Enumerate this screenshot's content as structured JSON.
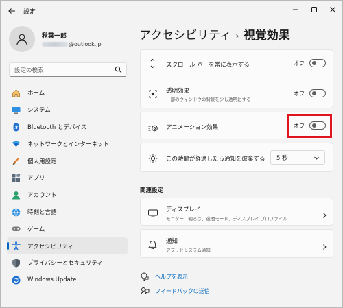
{
  "window": {
    "title": "設定",
    "page_breadcrumb_parent": "アクセシビリティ",
    "page_breadcrumb_sep": "›",
    "page_title": "視覚効果"
  },
  "profile": {
    "name": "秋葉一郎",
    "email_domain": "@outlook.jp"
  },
  "search": {
    "placeholder": "設定の検索"
  },
  "nav": {
    "items": [
      {
        "label": "ホーム",
        "icon": "home-icon"
      },
      {
        "label": "システム",
        "icon": "system-icon"
      },
      {
        "label": "Bluetooth とデバイス",
        "icon": "bluetooth-icon"
      },
      {
        "label": "ネットワークとインターネット",
        "icon": "network-icon"
      },
      {
        "label": "個人用設定",
        "icon": "personalization-icon"
      },
      {
        "label": "アプリ",
        "icon": "apps-icon"
      },
      {
        "label": "アカウント",
        "icon": "account-icon"
      },
      {
        "label": "時刻と言語",
        "icon": "time-language-icon"
      },
      {
        "label": "ゲーム",
        "icon": "gaming-icon"
      },
      {
        "label": "アクセシビリティ",
        "icon": "accessibility-icon",
        "active": true
      },
      {
        "label": "プライバシーとセキュリティ",
        "icon": "privacy-icon"
      },
      {
        "label": "Windows Update",
        "icon": "windows-update-icon"
      }
    ]
  },
  "settings": {
    "scrollbars": {
      "label": "スクロール バーを常に表示する",
      "state": "オフ"
    },
    "transparency": {
      "label": "透明効果",
      "sub": "一部のウィンドウの背景を少し透明にする",
      "state": "オフ"
    },
    "animation": {
      "label": "アニメーション効果",
      "state": "オフ"
    },
    "notification": {
      "label": "この時間が経過したら通知を破棄する",
      "value": "5 秒"
    }
  },
  "related": {
    "title": "関連設定",
    "display": {
      "label": "ディスプレイ",
      "sub": "モニター、明るさ、夜間モード、ディスプレイ プロファイル"
    },
    "notifications": {
      "label": "通知",
      "sub": "アプリとシステム通知"
    }
  },
  "links": {
    "help": "ヘルプを表示",
    "feedback": "フィードバックの送信"
  },
  "colors": {
    "accent": "#0067c0",
    "highlight": "#e0141e"
  }
}
